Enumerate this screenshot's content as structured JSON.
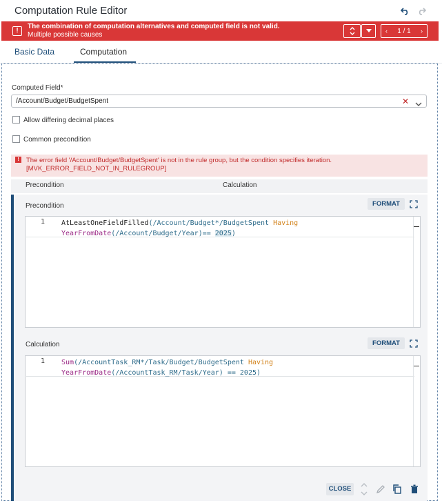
{
  "header": {
    "title": "Computation Rule Editor"
  },
  "banner": {
    "message_title": "The combination of computation alternatives and computed field is not valid.",
    "message_detail": "Multiple possible causes",
    "pager": "1 / 1",
    "color": "#d93737"
  },
  "tabs": [
    {
      "label": "Basic Data",
      "active": false
    },
    {
      "label": "Computation",
      "active": true
    }
  ],
  "computed_field": {
    "label": "Computed Field*",
    "value": "/Account/Budget/BudgetSpent"
  },
  "checkboxes": {
    "allow_decimal": {
      "label": "Allow differing decimal places",
      "checked": false
    },
    "common_precondition": {
      "label": "Common precondition",
      "checked": false
    }
  },
  "error": {
    "text_line1": "The error field '/Account/Budget/BudgetSpent' is not in the rule group, but the condition specifies iteration.",
    "text_line2": "[MVK_ERROR_FIELD_NOT_IN_RULEGROUP]"
  },
  "columns": {
    "precondition": "Precondition",
    "calculation": "Calculation"
  },
  "precondition": {
    "title": "Precondition",
    "format_label": "FORMAT",
    "line_number": "1",
    "code": {
      "fn": "AtLeastOneFieldFilled",
      "a": "(/Account/Budget*/BudgetSpent ",
      "having": "Having",
      "b": " ",
      "yfd": "YearFromDate",
      "c": "(/Account/",
      "d": "Budget/Year)== ",
      "num": "2025",
      "e": ")"
    }
  },
  "calculation": {
    "title": "Calculation",
    "format_label": "FORMAT",
    "line_number": "1",
    "code": {
      "fn": "Sum",
      "a": "(/AccountTask_RM*/Task/Budget/BudgetSpent ",
      "having": "Having",
      "b": " ",
      "yfd": "YearFromDate",
      "c": "(/AccountTask_RM/",
      "d": "Task/Year) == 2025)"
    }
  },
  "footer": {
    "close_label": "CLOSE"
  },
  "colors": {
    "accent": "#1f4e79",
    "error": "#c12a2a"
  }
}
